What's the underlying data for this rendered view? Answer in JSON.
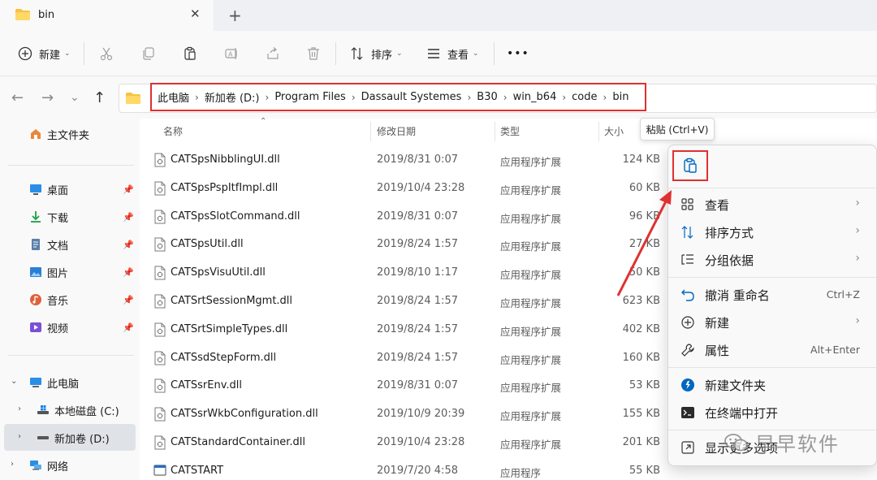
{
  "tab": {
    "title": "bin",
    "close": "✕",
    "new_tab": "+"
  },
  "toolbar": {
    "new_label": "新建",
    "sort_label": "排序",
    "view_label": "查看",
    "more": "•••"
  },
  "breadcrumb": [
    "此电脑",
    "新加卷 (D:)",
    "Program Files",
    "Dassault Systemes",
    "B30",
    "win_b64",
    "code",
    "bin"
  ],
  "sidebar": {
    "home": "主文件夹",
    "pinned": [
      {
        "label": "桌面",
        "icon": "desktop-icon"
      },
      {
        "label": "下载",
        "icon": "download-icon"
      },
      {
        "label": "文档",
        "icon": "document-icon"
      },
      {
        "label": "图片",
        "icon": "picture-icon"
      },
      {
        "label": "音乐",
        "icon": "music-icon"
      },
      {
        "label": "视频",
        "icon": "video-icon"
      }
    ],
    "this_pc": "此电脑",
    "drive_c": "本地磁盘 (C:)",
    "drive_d": "新加卷 (D:)",
    "network": "网络"
  },
  "columns": {
    "name": "名称",
    "date": "修改日期",
    "type": "类型",
    "size": "大小"
  },
  "files": [
    {
      "name": "CATSpsNibblingUI.dll",
      "date": "2019/8/31 0:07",
      "type": "应用程序扩展",
      "size": "124 KB"
    },
    {
      "name": "CATSpsPspItfImpl.dll",
      "date": "2019/10/4 23:28",
      "type": "应用程序扩展",
      "size": "60 KB"
    },
    {
      "name": "CATSpsSlotCommand.dll",
      "date": "2019/8/31 0:07",
      "type": "应用程序扩展",
      "size": "96 KB"
    },
    {
      "name": "CATSpsUtil.dll",
      "date": "2019/8/24 1:57",
      "type": "应用程序扩展",
      "size": "27 KB"
    },
    {
      "name": "CATSpsVisuUtil.dll",
      "date": "2019/8/10 1:17",
      "type": "应用程序扩展",
      "size": "50 KB"
    },
    {
      "name": "CATSrtSessionMgmt.dll",
      "date": "2019/8/24 1:57",
      "type": "应用程序扩展",
      "size": "623 KB"
    },
    {
      "name": "CATSrtSimpleTypes.dll",
      "date": "2019/8/24 1:57",
      "type": "应用程序扩展",
      "size": "402 KB"
    },
    {
      "name": "CATSsdStepForm.dll",
      "date": "2019/8/24 1:57",
      "type": "应用程序扩展",
      "size": "160 KB"
    },
    {
      "name": "CATSsrEnv.dll",
      "date": "2019/8/31 0:07",
      "type": "应用程序扩展",
      "size": "53 KB"
    },
    {
      "name": "CATSsrWkbConfiguration.dll",
      "date": "2019/10/9 20:39",
      "type": "应用程序扩展",
      "size": "155 KB"
    },
    {
      "name": "CATStandardContainer.dll",
      "date": "2019/10/4 23:28",
      "type": "应用程序扩展",
      "size": "201 KB"
    },
    {
      "name": "CATSTART",
      "date": "2019/7/20 4:58",
      "type": "应用程序",
      "size": "55 KB"
    }
  ],
  "tooltip": "粘贴 (Ctrl+V)",
  "context_menu": {
    "view": "查看",
    "sort": "排序方式",
    "group": "分组依据",
    "undo": "撤消 重命名",
    "undo_shortcut": "Ctrl+Z",
    "new": "新建",
    "properties": "属性",
    "properties_shortcut": "Alt+Enter",
    "new_folder": "新建文件夹",
    "open_terminal": "在终端中打开",
    "show_more": "显示更多选项"
  },
  "watermark": "早早软件",
  "colors": {
    "highlight_red": "#e03030",
    "folder_yellow": "#f5c242",
    "accent_blue": "#0067c0"
  }
}
